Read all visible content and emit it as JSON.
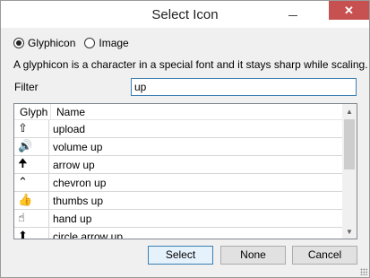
{
  "window": {
    "title": "Select Icon",
    "close_symbol": "✕"
  },
  "source": {
    "options": [
      {
        "label": "Glyphicon",
        "checked": true
      },
      {
        "label": "Image",
        "checked": false
      }
    ]
  },
  "description": "A glyphicon is a character in a special font and it stays sharp while scaling.",
  "filter": {
    "label": "Filter",
    "value": "up"
  },
  "list": {
    "columns": [
      "Glyph",
      "Name"
    ],
    "rows": [
      {
        "glyph": "⇧",
        "icon": "upload-icon",
        "name": "upload"
      },
      {
        "glyph": "🔊",
        "icon": "volume-up-icon",
        "name": "volume up"
      },
      {
        "glyph": "🠉",
        "icon": "arrow-up-icon",
        "name": "arrow up"
      },
      {
        "glyph": "⌃",
        "icon": "chevron-up-icon",
        "name": "chevron up"
      },
      {
        "glyph": "👍",
        "icon": "thumbs-up-icon",
        "name": "thumbs up"
      },
      {
        "glyph": "☝",
        "icon": "hand-up-icon",
        "name": "hand up"
      },
      {
        "glyph": "⬆",
        "icon": "circle-arrow-up-icon",
        "name": "circle arrow up"
      }
    ]
  },
  "buttons": {
    "select": "Select",
    "none": "None",
    "cancel": "Cancel"
  }
}
